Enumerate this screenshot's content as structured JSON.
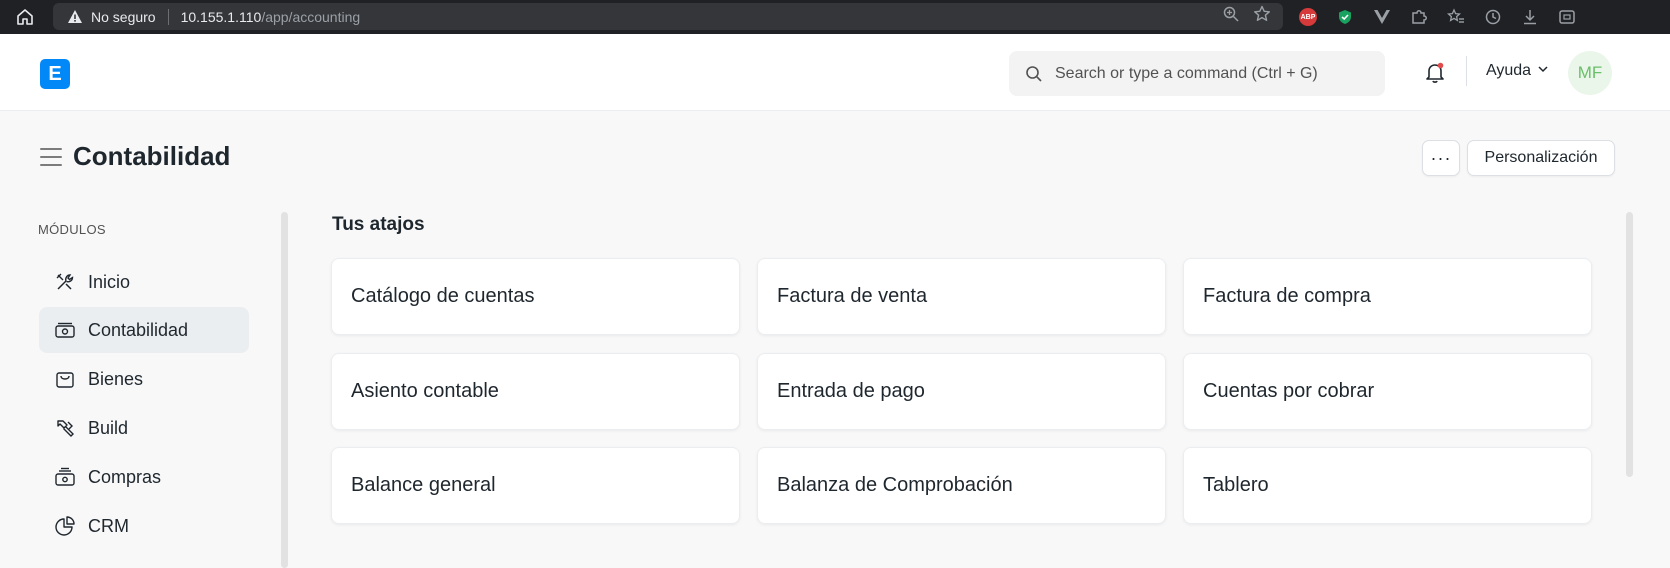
{
  "browser": {
    "security_label": "No seguro",
    "url_host": "10.155.1.110",
    "url_path": "/app/accounting",
    "extensions": [
      "abp-icon",
      "shield-extension-icon",
      "vuejs-icon",
      "puzzle-icon",
      "bookmarks-icon",
      "history-icon",
      "download-icon",
      "screenshot-icon"
    ],
    "abp_label": "ABP"
  },
  "navbar": {
    "logo_letter": "E",
    "search_placeholder": "Search or type a command (Ctrl + G)",
    "help_label": "Ayuda",
    "avatar_initials": "MF"
  },
  "page": {
    "title": "Contabilidad",
    "more_label": "···",
    "customize_label": "Personalización"
  },
  "sidebar": {
    "heading": "MÓDULOS",
    "items": [
      {
        "label": "Inicio",
        "icon": "tools-icon",
        "active": false
      },
      {
        "label": "Contabilidad",
        "icon": "accounting-icon",
        "active": true
      },
      {
        "label": "Bienes",
        "icon": "bag-icon",
        "active": false
      },
      {
        "label": "Build",
        "icon": "hammer-icon",
        "active": false
      },
      {
        "label": "Compras",
        "icon": "purchase-icon",
        "active": false
      },
      {
        "label": "CRM",
        "icon": "crm-chart-icon",
        "active": false
      }
    ]
  },
  "main": {
    "section_title": "Tus atajos",
    "shortcuts": [
      {
        "label": "Catálogo de cuentas"
      },
      {
        "label": "Factura de venta"
      },
      {
        "label": "Factura de compra"
      },
      {
        "label": "Asiento contable"
      },
      {
        "label": "Entrada de pago"
      },
      {
        "label": "Cuentas por cobrar"
      },
      {
        "label": "Balance general"
      },
      {
        "label": "Balanza de Comprobación"
      },
      {
        "label": "Tablero"
      }
    ]
  },
  "colors": {
    "brand": "#0289f7",
    "notification_dot": "#e24c4c",
    "avatar_text": "#6bbf6b"
  }
}
